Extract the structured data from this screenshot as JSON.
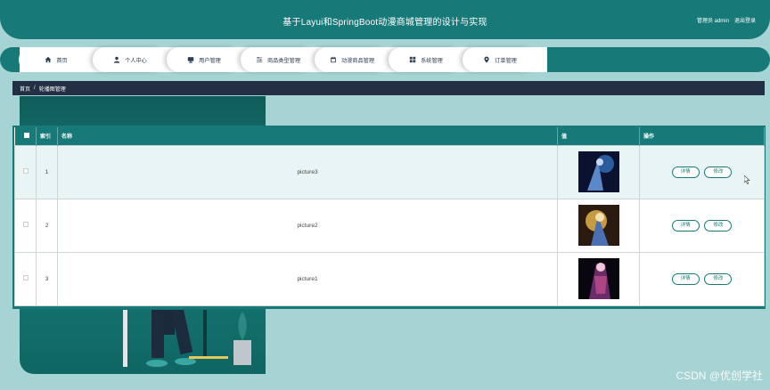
{
  "header": {
    "title": "基于Layui和SpringBoot动漫商城管理的设计与实现",
    "user_label": "管理员 admin",
    "logout": "退出登录"
  },
  "nav": [
    {
      "label": "首页",
      "icon": "home-icon"
    },
    {
      "label": "个人中心",
      "icon": "user-icon"
    },
    {
      "label": "用户管理",
      "icon": "monitor-icon"
    },
    {
      "label": "商品类型管理",
      "icon": "sliders-icon"
    },
    {
      "label": "动漫商品管理",
      "icon": "calendar-icon"
    },
    {
      "label": "系统管理",
      "icon": "grid-icon"
    },
    {
      "label": "订单管理",
      "icon": "location-icon"
    }
  ],
  "breadcrumb": {
    "home": "首页",
    "sep": "/",
    "current": "轮播图管理"
  },
  "table": {
    "headers": {
      "index": "索引",
      "name": "名称",
      "value": "值",
      "actions": "操作"
    },
    "rows": [
      {
        "index": "1",
        "name": "picture3",
        "detail": "详情",
        "edit": "修改"
      },
      {
        "index": "2",
        "name": "picture2",
        "detail": "详情",
        "edit": "修改"
      },
      {
        "index": "3",
        "name": "picture1",
        "detail": "详情",
        "edit": "修改"
      }
    ]
  },
  "watermark": "CSDN @优创学社",
  "colors": {
    "primary": "#187a78",
    "breadcrumb": "#232f44",
    "background": "#a6d3d3"
  }
}
